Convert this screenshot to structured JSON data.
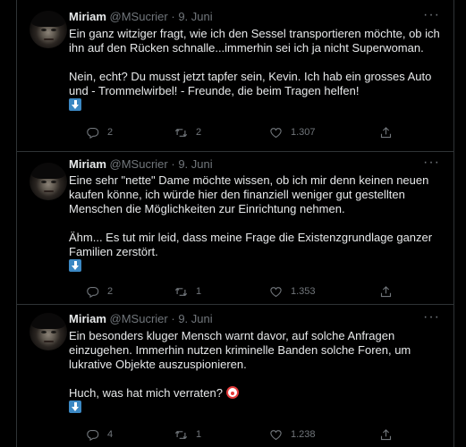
{
  "tweets": [
    {
      "author_name": "Miriam",
      "handle": "@MSucrier",
      "separator": "·",
      "date": "9. Juni",
      "paragraphs": [
        "Ein ganz witziger fragt, wie ich den Sessel transportieren möchte, ob ich ihn auf den Rücken schnalle...immerhin sei ich ja nicht Superwoman.",
        "Nein, echt? Du musst jetzt tapfer sein, Kevin. Ich hab ein grosses Auto und - Trommelwirbel! - Freunde, die beim Tragen helfen!"
      ],
      "replies": "2",
      "retweets": "2",
      "likes": "1.307"
    },
    {
      "author_name": "Miriam",
      "handle": "@MSucrier",
      "separator": "·",
      "date": "9. Juni",
      "paragraphs": [
        "Eine sehr \"nette\" Dame möchte wissen, ob ich mir denn keinen neuen kaufen könne, ich würde hier den finanziell weniger gut gestellten Menschen die Möglichkeiten zur Einrichtung nehmen.",
        "Ähm... Es tut mir leid, dass meine Frage die Existenzgrundlage ganzer Familien zerstört."
      ],
      "replies": "2",
      "retweets": "1",
      "likes": "1.353"
    },
    {
      "author_name": "Miriam",
      "handle": "@MSucrier",
      "separator": "·",
      "date": "9. Juni",
      "paragraphs": [
        "Ein besonders kluger Mensch warnt davor, auf solche Anfragen einzugehen. Immerhin nutzen kriminelle Banden solche Foren, um lukrative Objekte auszuspionieren.",
        "Huch, was hat mich verraten?"
      ],
      "replies": "4",
      "retweets": "1",
      "likes": "1.238"
    }
  ],
  "icons": {
    "more": "more-horizontal-icon",
    "reply": "reply-icon",
    "retweet": "retweet-icon",
    "like": "heart-icon",
    "share": "share-icon",
    "thread_arrow": "down-arrow-emoji",
    "clown": "clown-face-emoji"
  },
  "colors": {
    "background": "#000000",
    "text": "#e7e9ea",
    "muted": "#71767b",
    "divider": "#2f3336",
    "arrow_emoji": "#3b88c3"
  }
}
